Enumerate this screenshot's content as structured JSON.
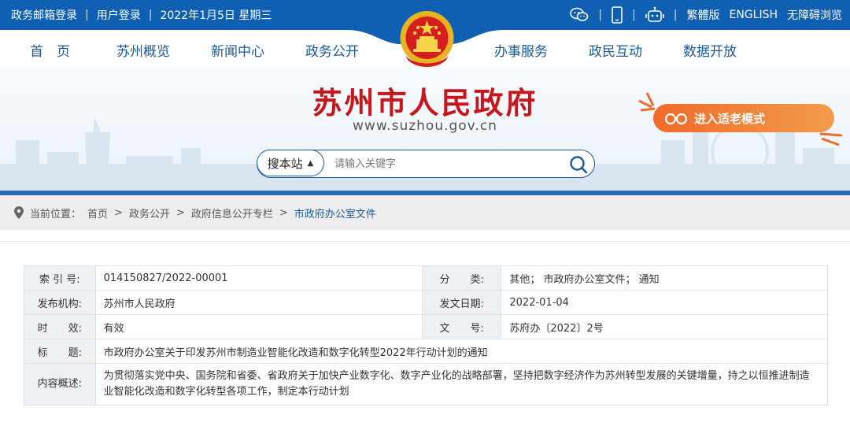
{
  "topbar": {
    "left": [
      "政务邮箱登录",
      "用户登录",
      "2022年1月5日 星期三"
    ],
    "separator": "|",
    "right": {
      "wechat_icon": "wechat-icon",
      "mobile_icon": "mobile-icon",
      "robot_icon": "robot-icon",
      "traditional": "繁體版",
      "english": "ENGLISH",
      "accessible": "无障碍浏览"
    }
  },
  "nav": {
    "items": [
      "首　页",
      "苏州概览",
      "新闻中心",
      "政务公开",
      "办事服务",
      "政民互动",
      "数据开放"
    ],
    "active": "政务公开"
  },
  "header": {
    "title": "苏州市人民政府",
    "url": "www.suzhou.gov.cn",
    "senior_mode": "进入适老模式"
  },
  "search": {
    "scope": "搜本站",
    "placeholder": "请输入关键字"
  },
  "breadcrumb": {
    "label": "当前位置：",
    "items": [
      "首页",
      "政务公开",
      "政府信息公开专栏",
      "市政府办公室文件"
    ],
    "separator": ">"
  },
  "info": {
    "index_label": "索 引 号:",
    "index_value": "014150827/2022-00001",
    "category_label": "分　　类:",
    "category_value": "其他； 市政府办公室文件； 通知",
    "publisher_label": "发布机构:",
    "publisher_value": "苏州市人民政府",
    "date_label": "发文日期:",
    "date_value": "2022-01-04",
    "validity_label": "时　　效:",
    "validity_value": "有效",
    "docno_label": "文　　号:",
    "docno_value": "苏府办〔2022〕2号",
    "title_label": "标　　题:",
    "title_value": "市政府办公室关于印发苏州市制造业智能化改造和数字化转型2022年行动计划的通知",
    "summary_label": "内容概述:",
    "summary_value": "为贯彻落实党中央、国务院和省委、省政府关于加快产业数字化、数字产业化的战略部署，坚持把数字经济作为苏州转型发展的关键增量，持之以恒推进制造业智能化改造和数字化转型各项工作，制定本行动计划"
  },
  "colors": {
    "topbar": "#0f5fb3",
    "nav_text": "#1a5a98",
    "title_red": "#c8161d",
    "senior_orange": "#f06a2b"
  }
}
